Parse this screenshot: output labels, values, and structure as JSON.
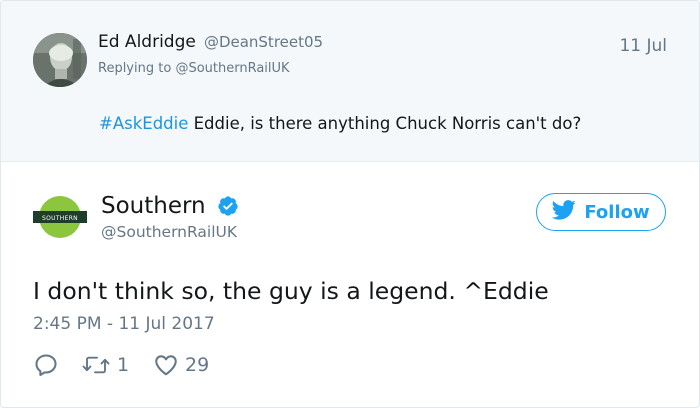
{
  "reply_tweet": {
    "author_name": "Ed Aldridge",
    "author_handle": "@DeanStreet05",
    "date": "11 Jul",
    "replying_prefix": "Replying to",
    "replying_to": "@SouthernRailUK",
    "hashtag": "#AskEddie",
    "body": " Eddie, is there anything Chuck Norris can't do?"
  },
  "tweet": {
    "author_name": "Southern",
    "author_handle": "@SouthernRailUK",
    "verified": true,
    "logo_text": "SOUTHERN",
    "follow_label": "Follow",
    "body": "I don't think so, the guy is a legend. ^Eddie",
    "timestamp": "2:45 PM - 11 Jul 2017",
    "retweet_count": "1",
    "like_count": "29"
  },
  "colors": {
    "accent": "#1da1f2",
    "hashtag": "#1b95e0",
    "muted": "#657786",
    "reply_bg": "#f5f8fa",
    "logo_green": "#8cc63f",
    "logo_dark": "#1e3d2a"
  },
  "icons": {
    "reply": "reply-icon",
    "retweet": "retweet-icon",
    "like": "heart-icon",
    "verified": "verified-badge-icon",
    "follow": "twitter-bird-icon"
  }
}
